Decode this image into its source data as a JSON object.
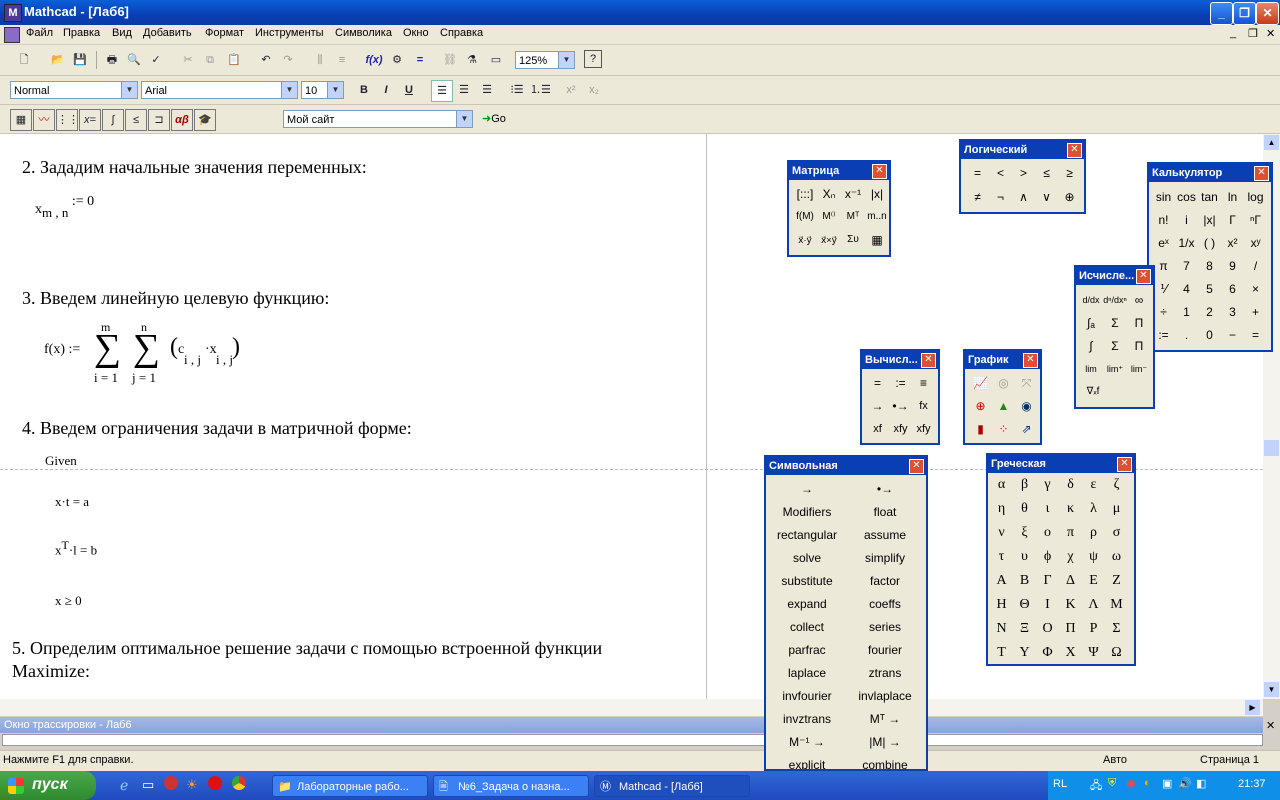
{
  "window": {
    "title": "Mathcad - [Лаб6]",
    "buttons": [
      "_",
      "❐",
      "✕"
    ]
  },
  "menu": [
    "Файл",
    "Правка",
    "Вид",
    "Добавить",
    "Формат",
    "Инструменты",
    "Символика",
    "Окно",
    "Справка"
  ],
  "format_toolbar": {
    "style": "Normal",
    "font": "Arial",
    "size": "10",
    "bold": "B",
    "italic": "I",
    "underline": "U"
  },
  "standard_toolbar": {
    "zoom": "125%"
  },
  "web_toolbar": {
    "site": "Мой сайт",
    "go": "Go"
  },
  "document": {
    "step2": "2. Зададим начальные значения переменных:",
    "step2_expr": {
      "var": "x",
      "sub": "m , n",
      "assign": ":= 0"
    },
    "step3": "3. Введем линейную целевую функцию:",
    "step3_expr": {
      "lhs": "f(x) :=",
      "sum1_top": "m",
      "sum1_bot": "i = 1",
      "sum2_top": "n",
      "sum2_bot": "j = 1",
      "c": "c",
      "c_sub": "i , j",
      "dot": "·x",
      "x_sub": "i , j"
    },
    "step4": "4. Введем ограничения задачи в матричной форме:",
    "given": "Given",
    "c1": "x·t = a",
    "c2_x": "x",
    "c2_sup": "T",
    "c2_rest": "·l = b",
    "c3": "x ≥ 0",
    "step5_line1": "5. Определим оптимальное решение задачи с помощью встроенной функции",
    "step5_line2": "Maximize:"
  },
  "palettes": {
    "matrix": {
      "title": "Матрица",
      "items": [
        "[:::]",
        "Xₙ",
        "x⁻¹",
        "|x|",
        "f(M)",
        "M⁽⁾",
        "Mᵀ",
        "m..n",
        "x⃗·y⃗",
        "x⃗×y⃗",
        "Συ",
        "▦"
      ]
    },
    "logic": {
      "title": "Логический",
      "items": [
        "=",
        "<",
        ">",
        "≤",
        "≥",
        "≠",
        "¬",
        "∧",
        "∨",
        "⊕"
      ]
    },
    "calculator": {
      "title": "Калькулятор",
      "items": [
        "sin",
        "cos",
        "tan",
        "ln",
        "log",
        "n!",
        "i",
        "|x|",
        "Γ",
        "ⁿΓ",
        "eˣ",
        "1/x",
        "( )",
        "x²",
        "xʸ",
        "π",
        "7",
        "8",
        "9",
        "/",
        "⅟",
        "4",
        "5",
        "6",
        "×",
        "÷",
        "1",
        "2",
        "3",
        "+",
        ":=",
        ".",
        "0",
        "−",
        "="
      ]
    },
    "calculus": {
      "title": "Исчисле...",
      "items": [
        "d/dx",
        "dⁿ/dxⁿ",
        "∞",
        "∫ₐ",
        "Σ",
        "Π",
        "∫",
        "Σ",
        "Π",
        "lim",
        "lim⁺",
        "lim⁻",
        "∇ₓf"
      ]
    },
    "evaluation": {
      "title": "Вычисл...",
      "items": [
        "=",
        ":=",
        "≡",
        "→",
        "•→",
        "fx",
        "xf",
        "xfy",
        "xfy"
      ]
    },
    "graph": {
      "title": "График",
      "items": [
        "chart",
        "polar",
        "3d",
        "target",
        "surface",
        "contour",
        "bar",
        "scatter",
        "vector"
      ]
    },
    "symbolic": {
      "title": "Символьная",
      "items": [
        "→",
        "•→",
        "Modifiers",
        "float",
        "rectangular",
        "assume",
        "solve",
        "simplify",
        "substitute",
        "factor",
        "expand",
        "coeffs",
        "collect",
        "series",
        "parfrac",
        "fourier",
        "laplace",
        "ztrans",
        "invfourier",
        "invlaplace",
        "invztrans",
        "Mᵀ →",
        "M⁻¹ →",
        "|M| →",
        "explicit",
        "combine"
      ]
    },
    "greek": {
      "title": "Греческая",
      "items": [
        "α",
        "β",
        "γ",
        "δ",
        "ε",
        "ζ",
        "η",
        "θ",
        "ι",
        "κ",
        "λ",
        "μ",
        "ν",
        "ξ",
        "ο",
        "π",
        "ρ",
        "σ",
        "τ",
        "υ",
        "ϕ",
        "χ",
        "ψ",
        "ω",
        "Α",
        "Β",
        "Γ",
        "Δ",
        "Ε",
        "Ζ",
        "Η",
        "Θ",
        "Ι",
        "Κ",
        "Λ",
        "Μ",
        "Ν",
        "Ξ",
        "Ο",
        "Π",
        "Ρ",
        "Σ",
        "Τ",
        "Υ",
        "Φ",
        "Χ",
        "Ψ",
        "Ω"
      ]
    }
  },
  "trace_window": "Окно трассировки - Лаб6",
  "status": {
    "help": "Нажмите F1 для справки.",
    "mode": "Авто",
    "page": "Страница 1"
  },
  "taskbar": {
    "start": "пуск",
    "tasks": [
      "Лабораторные рабо...",
      "№6_Задача о назна...",
      "Mathcad - [Лаб6]"
    ],
    "lang": "RL",
    "clock": "21:37"
  }
}
